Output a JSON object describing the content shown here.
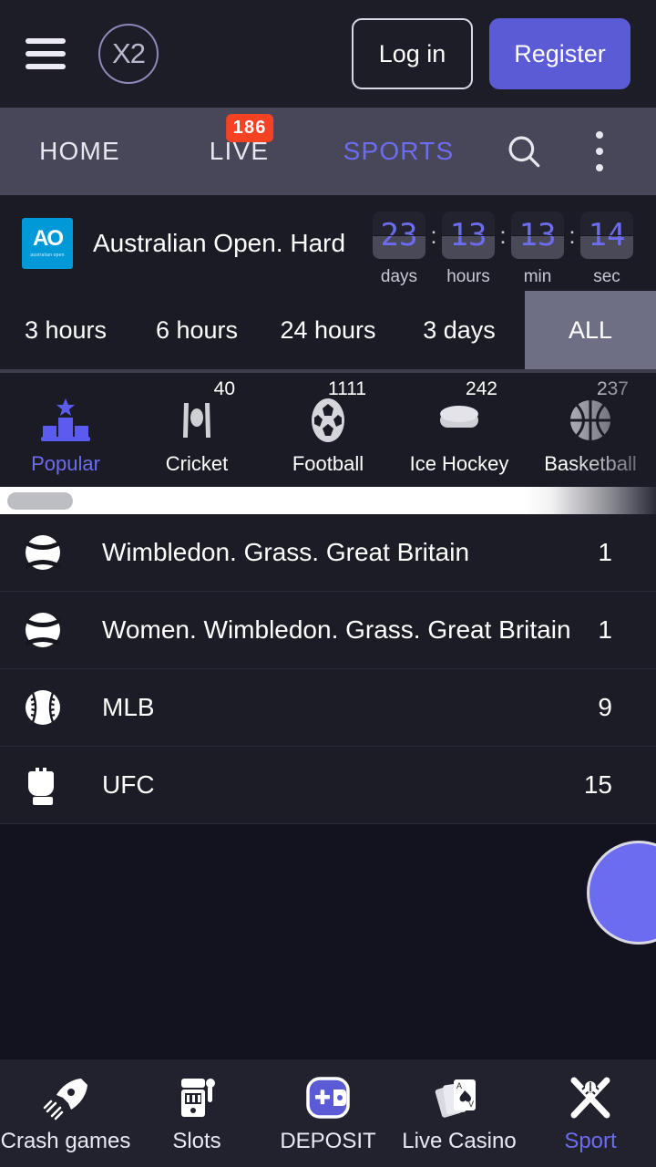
{
  "header": {
    "menu_icon": "hamburger-icon",
    "logo_text": "X2",
    "login_label": "Log in",
    "register_label": "Register"
  },
  "nav": {
    "tabs": [
      {
        "label": "HOME",
        "active": false,
        "badge": null
      },
      {
        "label": "LIVE",
        "active": false,
        "badge": "186"
      },
      {
        "label": "SPORTS",
        "active": true,
        "badge": null
      }
    ],
    "search_icon": "search-icon",
    "overflow_icon": "kebab-menu-icon"
  },
  "banner": {
    "logo_mark": "AO",
    "logo_sub": "australian open",
    "title": "Australian Open. Hard",
    "countdown": [
      {
        "value": "23",
        "label": "days"
      },
      {
        "value": "13",
        "label": "hours"
      },
      {
        "value": "13",
        "label": "min"
      },
      {
        "value": "14",
        "label": "sec"
      }
    ],
    "separator": ":"
  },
  "time_filters": [
    {
      "label": "3 hours",
      "active": false
    },
    {
      "label": "6 hours",
      "active": false
    },
    {
      "label": "24 hours",
      "active": false
    },
    {
      "label": "3 days",
      "active": false
    },
    {
      "label": "ALL",
      "active": true
    }
  ],
  "sport_categories": [
    {
      "label": "Popular",
      "count": "",
      "icon": "podium-star-icon",
      "active": true
    },
    {
      "label": "Cricket",
      "count": "40",
      "icon": "cricket-icon",
      "active": false
    },
    {
      "label": "Football",
      "count": "1111",
      "icon": "football-icon",
      "active": false
    },
    {
      "label": "Ice Hockey",
      "count": "242",
      "icon": "ice-hockey-icon",
      "active": false
    },
    {
      "label": "Basketball",
      "count": "237",
      "icon": "basketball-icon",
      "active": false
    }
  ],
  "leagues": [
    {
      "name": "Wimbledon. Grass. Great Britain",
      "count": "1",
      "icon": "tennis-ball-icon"
    },
    {
      "name": "Women. Wimbledon. Grass. Great Britain",
      "count": "1",
      "icon": "tennis-ball-icon"
    },
    {
      "name": "MLB",
      "count": "9",
      "icon": "baseball-icon"
    },
    {
      "name": "UFC",
      "count": "15",
      "icon": "mma-glove-icon"
    }
  ],
  "bottom_nav": [
    {
      "label": "Crash games",
      "icon": "rocket-icon",
      "active": false
    },
    {
      "label": "Slots",
      "icon": "slot-machine-icon",
      "active": false
    },
    {
      "label": "DEPOSIT",
      "icon": "wallet-plus-icon",
      "active": false
    },
    {
      "label": "Live Casino",
      "icon": "playing-cards-icon",
      "active": false
    },
    {
      "label": "Sport",
      "icon": "crossed-bats-icon",
      "active": true
    }
  ],
  "colors": {
    "accent": "#6c6cf0",
    "register": "#5b5bd6",
    "badge": "#f44222",
    "ao_blue": "#0099d8"
  }
}
